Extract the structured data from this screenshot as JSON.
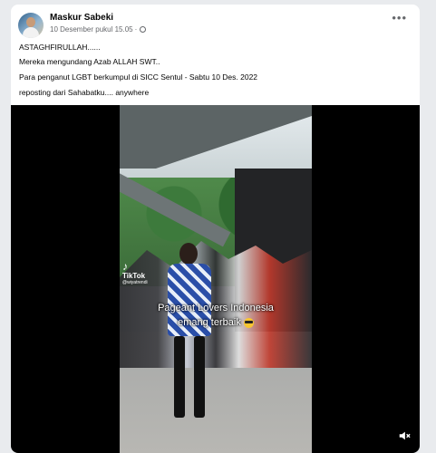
{
  "post": {
    "author": "Maskur Sabeki",
    "timestamp": "10 Desember pukul 15.05",
    "privacy_icon": "globe-icon",
    "more_icon": "more-options-icon",
    "lines": [
      "ASTAGHFIRULLAH......",
      "Mereka mengundang Azab ALLAH SWT..",
      "Para penganut LGBT berkumpul di SICC Sentul - Sabtu 10 Des. 2022",
      "reposting dari Sahabatku.... anywhere"
    ]
  },
  "video": {
    "watermark": "TikTok",
    "watermark_handle": "@wiyatrendi",
    "caption_line1": "Pageant Lovers Indonesia",
    "caption_line2": "emang terbaik",
    "caption_emoji": "smiling-face-with-sunglasses-icon",
    "mute_icon": "speaker-muted-icon"
  },
  "colors": {
    "background": "#e9ebee",
    "card": "#ffffff",
    "secondary_text": "#65676b",
    "video_bg": "#000000"
  }
}
